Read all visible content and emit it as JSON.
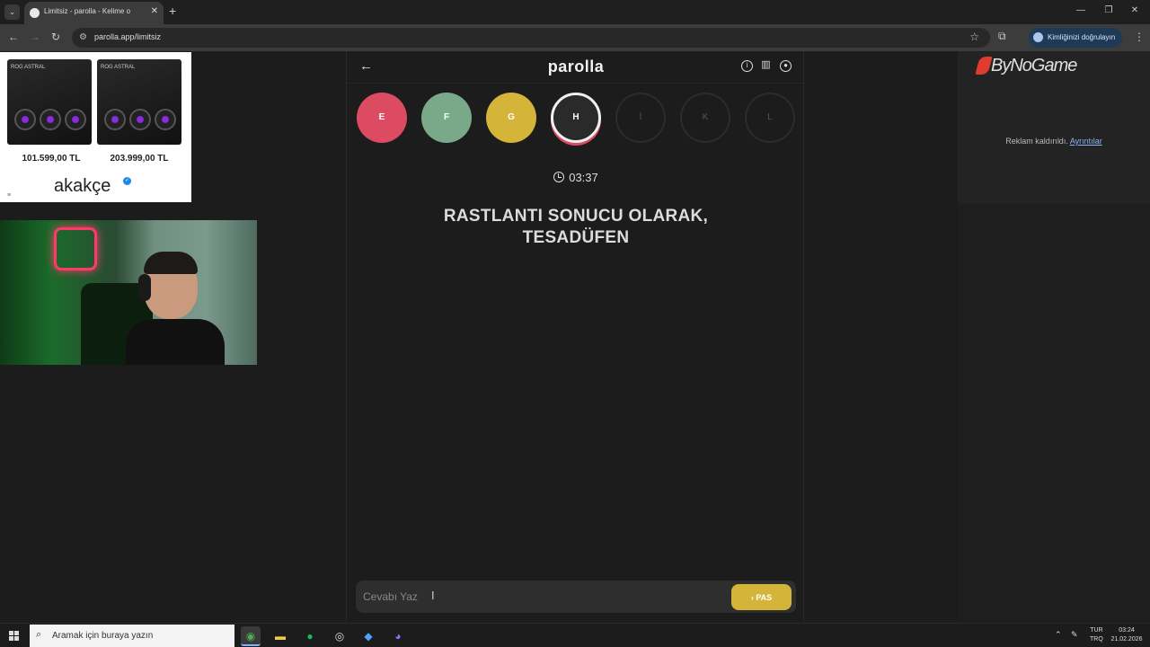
{
  "browser": {
    "tab_title": "Limitsiz - parolla - Kelime o",
    "url": "parolla.app/limitsiz",
    "identity_label": "Kimliğinizi doğrulayın"
  },
  "left_ad": {
    "price_1": "101.599,00 TL",
    "price_2": "203.999,00 TL",
    "brand": "akakçe",
    "product_label": "ROG ASTRAL"
  },
  "game": {
    "logo": "parolla",
    "letters": [
      {
        "letter": "E",
        "state": "wrong"
      },
      {
        "letter": "F",
        "state": "right"
      },
      {
        "letter": "G",
        "state": "pass"
      },
      {
        "letter": "H",
        "state": "current"
      },
      {
        "letter": "İ",
        "state": "pending"
      },
      {
        "letter": "K",
        "state": "pending"
      },
      {
        "letter": "L",
        "state": "pending"
      }
    ],
    "timer": "03:37",
    "clue_line1": "RASTLANTI SONUCU OLARAK,",
    "clue_line2": "TESADÜFEN",
    "answer_placeholder": "Cevabı Yaz",
    "pass_label": "PAS",
    "colors": {
      "wrong": "#dd4b62",
      "right": "#7aa98a",
      "pass": "#d4b53a"
    }
  },
  "right_ad": {
    "logo": "ByNoGame",
    "removed_text": "Reklam kaldırıldı.",
    "details_link": "Ayrıntılar"
  },
  "taskbar": {
    "search_placeholder": "Aramak için buraya yazın",
    "lang_top": "TUR",
    "lang_bottom": "TRQ",
    "time": "03:24",
    "date": "21.02.2026"
  }
}
